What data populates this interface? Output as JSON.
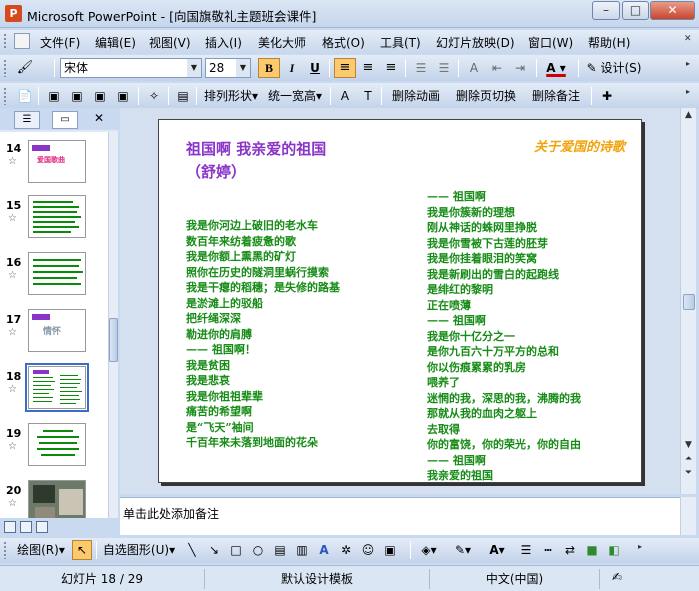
{
  "window": {
    "title": "Microsoft PowerPoint - [向国旗敬礼主题班会课件]"
  },
  "menu": [
    "文件(F)",
    "编辑(E)",
    "视图(V)",
    "插入(I)",
    "美化大师",
    "格式(O)",
    "工具(T)",
    "幻灯片放映(D)",
    "窗口(W)",
    "帮助(H)"
  ],
  "format_toolbar": {
    "font": "宋体",
    "size": "28",
    "bold": "B",
    "italic": "I",
    "underline": "U",
    "font_color_label": "A",
    "design": "设计(S)"
  },
  "tool_toolbar": {
    "layout": "排列形状",
    "uniform_width": "统一宽高",
    "delete_animation": "删除动画",
    "delete_transition": "删除页切换",
    "delete_notes": "删除备注"
  },
  "slides_panel": {
    "selected": "18",
    "thumbs": [
      {
        "num": "14",
        "text": "爱国歌曲"
      },
      {
        "num": "15",
        "text": ""
      },
      {
        "num": "16",
        "text": ""
      },
      {
        "num": "17",
        "text": "情怀"
      },
      {
        "num": "18",
        "text": ""
      },
      {
        "num": "19",
        "text": ""
      },
      {
        "num": "20",
        "text": ""
      }
    ]
  },
  "slide": {
    "title_line1": "祖国啊  我亲爱的祖国",
    "title_line2": "（舒婷）",
    "corner": "关于爱国的诗歌",
    "left_lines": [
      "我是你河边上破旧的老水车",
      "数百年来纺着疲惫的歌",
      "我是你额上熏黑的矿灯",
      "照你在历史的隧洞里蜗行摸索",
      "我是干瘪的稻穗；是失修的路基",
      "是淤滩上的驳船",
      "把纤绳深深",
      "勒进你的肩膊",
      "—— 祖国啊！",
      "我是贫困",
      "我是悲哀",
      "我是你祖祖辈辈",
      "痛苦的希望啊",
      "是“飞天”袖间",
      "千百年来未落到地面的花朵"
    ],
    "right_lines": [
      "—— 祖国啊",
      "我是你簇新的理想",
      "刚从神话的蛛网里挣脱",
      "我是你雪被下古莲的胚芽",
      "我是你挂着眼泪的笑窝",
      "我是新刷出的雪白的起跑线",
      "是绯红的黎明",
      "正在喷薄",
      "—— 祖国啊",
      "我是你十亿分之一",
      "是你九百六十万平方的总和",
      "你以伤痕累累的乳房",
      "喂养了",
      "迷惘的我，深思的我，沸腾的我",
      "那就从我的血肉之躯上",
      "去取得",
      "你的富饶，你的荣光，你的自由",
      "—— 祖国啊",
      "我亲爱的祖国"
    ]
  },
  "notes": {
    "placeholder": "单击此处添加备注"
  },
  "drawing_toolbar": {
    "draw": "绘图(R)",
    "autoshape": "自选图形(U)"
  },
  "status": {
    "slide": "幻灯片 18 / 29",
    "template": "默认设计模板",
    "language": "中文(中国)"
  }
}
